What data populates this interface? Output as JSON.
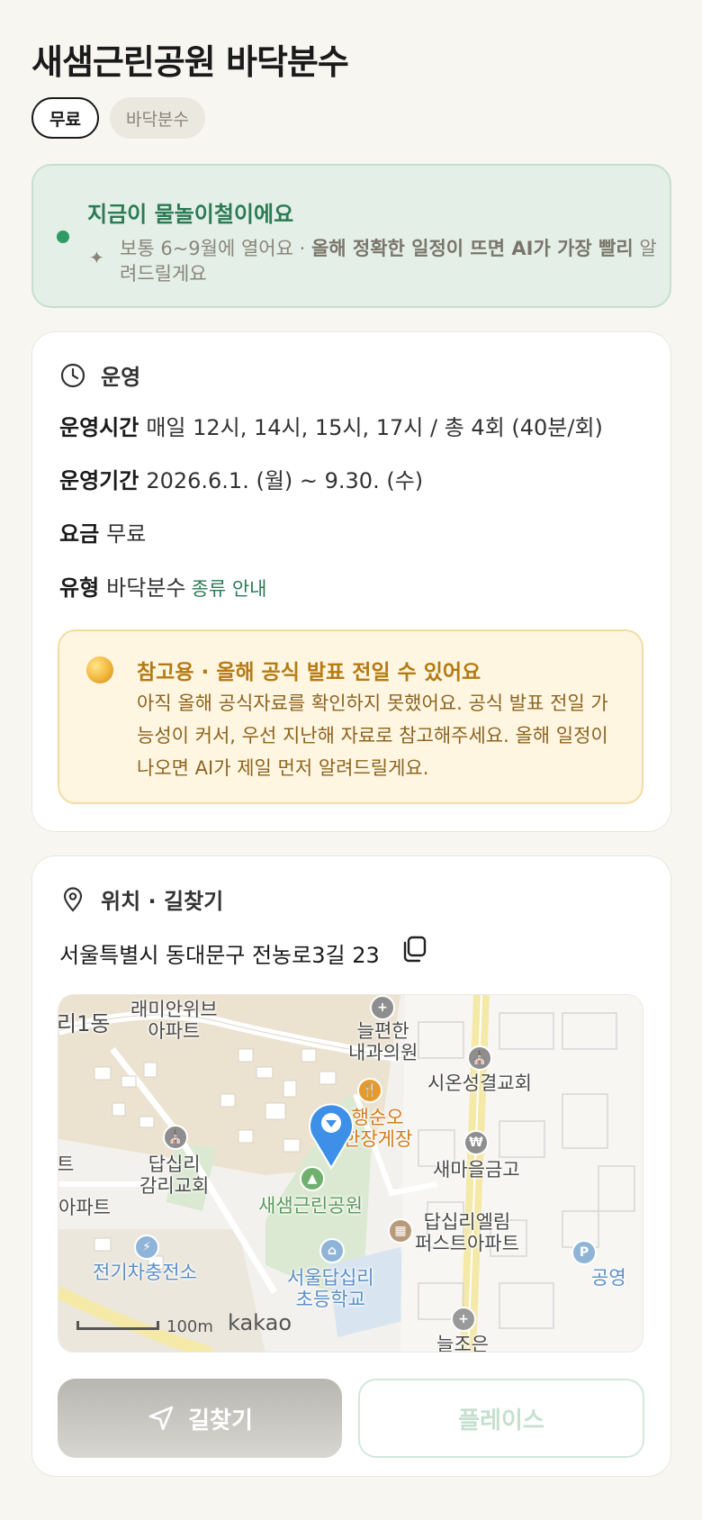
{
  "page": {
    "title": "새샘근린공원 바닥분수",
    "tags": [
      "무료",
      "바닥분수"
    ]
  },
  "season": {
    "title": "지금이 물놀이철이에요",
    "desc_lead": "보통 6~9월에 열어요 · ",
    "desc_bold": "올해 정확한 일정이 뜨면 AI가 가장 빨리",
    "desc_tail": "알려드릴게요"
  },
  "operation": {
    "section_title": "운영",
    "hours_label": "운영시간",
    "hours_value": "매일 12시, 14시, 15시, 17시 / 총 4회 (40분/회)",
    "period_label": "운영기간",
    "period_value": "2026.6.1. (월) ~ 9.30. (수)",
    "fee_label": "요금",
    "fee_value": "무료",
    "type_label": "유형",
    "type_value": "바닥분수",
    "type_link": "종류 안내"
  },
  "notice": {
    "title": "참고용 · 올해 공식 발표 전일 수 있어요",
    "body": "아직 올해 공식자료를 확인하지 못했어요. 공식 발표 전일 가능성이 커서, 우선 지난해 자료로 참고해주세요. 올해 일정이 나오면 AI가 제일 먼저 알려드릴게요."
  },
  "location": {
    "section_title": "위치 · 길찾기",
    "address": "서울특별시 동대문구 전농로3길 23",
    "map": {
      "labels": {
        "l1": "래미안위브\n아파트",
        "l2": "늘편한\n내과의원",
        "l3": "시온성결교회",
        "l4": "행순오\n한장게장",
        "l5": "답십리\n감리교회",
        "l6": "새마을금고",
        "l7": "새샘근린공원",
        "l8": "답십리엘림\n퍼스트아파트",
        "l9": "전기차충전소",
        "l10": "서울답십리\n초등학교",
        "l11": "공영",
        "l12": "늘조은",
        "l13": "리1동",
        "l14": "아파트",
        "l15": "트"
      },
      "scale": "100m",
      "brand": "kakao"
    },
    "route_button": "길찾기",
    "place_button": "플레이스"
  },
  "colors": {
    "accent_green": "#2c7a55",
    "notice_text": "#b57a12",
    "marker_blue": "#3d8fe8"
  }
}
